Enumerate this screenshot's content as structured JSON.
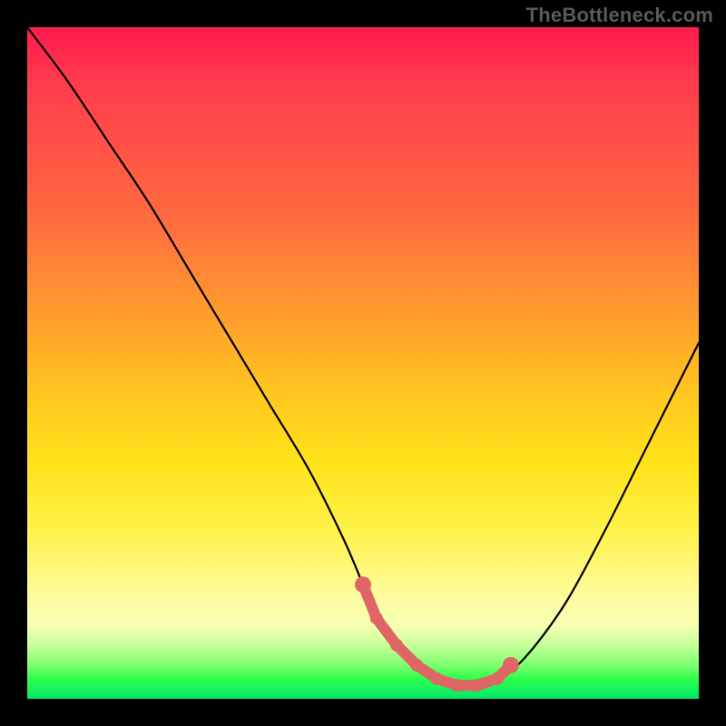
{
  "watermark": "TheBottleneck.com",
  "chart_data": {
    "type": "line",
    "title": "",
    "xlabel": "",
    "ylabel": "",
    "xlim": [
      0,
      100
    ],
    "ylim": [
      0,
      100
    ],
    "series": [
      {
        "name": "curve",
        "x": [
          0,
          6,
          12,
          18,
          24,
          30,
          36,
          42,
          47,
          50,
          52,
          55,
          58,
          61,
          64,
          67,
          70,
          74,
          80,
          86,
          92,
          98,
          100
        ],
        "values": [
          100,
          92,
          83,
          74,
          64,
          54,
          44,
          34,
          24,
          17,
          12,
          8,
          5,
          3,
          2,
          2,
          3,
          6,
          14,
          25,
          37,
          49,
          53
        ]
      },
      {
        "name": "highlight-dots",
        "x": [
          50,
          52,
          55,
          58,
          61,
          64,
          67,
          70,
          72
        ],
        "values": [
          17,
          12,
          8,
          5,
          3,
          2,
          2,
          3,
          5
        ]
      }
    ],
    "colors": {
      "curve": "#000000",
      "dots": "#e06666"
    },
    "gradient_stops": [
      {
        "pos": 0,
        "color": "#ff1a4d"
      },
      {
        "pos": 28,
        "color": "#ff6a3f"
      },
      {
        "pos": 55,
        "color": "#ffc81f"
      },
      {
        "pos": 75,
        "color": "#fff24a"
      },
      {
        "pos": 92,
        "color": "#c8ff9a"
      },
      {
        "pos": 100,
        "color": "#00e86b"
      }
    ]
  }
}
